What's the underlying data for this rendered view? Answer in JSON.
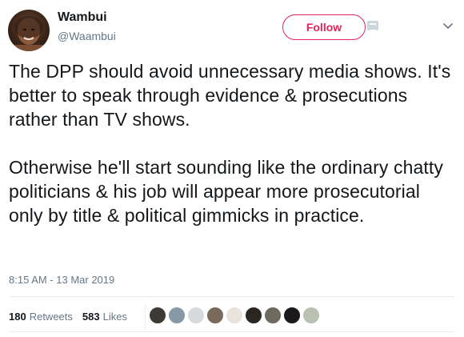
{
  "user": {
    "display_name": "Wambui",
    "handle": "@Waambui"
  },
  "follow_label": "Follow",
  "tweet": {
    "paragraphs": [
      "The DPP should avoid unnecessary media shows. It's better to speak through evidence & prosecutions rather than TV shows.",
      "Otherwise he'll start sounding like the ordinary chatty politicians & his job will appear more prosecutorial only by title & political gimmicks in practice."
    ]
  },
  "timestamp": "8:15 AM - 13 Mar 2019",
  "stats": {
    "retweets_count": "180",
    "retweets_label": "Retweets",
    "likes_count": "583",
    "likes_label": "Likes"
  },
  "colors": {
    "follow_accent": "#e0245e",
    "secondary_text": "#657786",
    "primary_text": "#14171a"
  },
  "liker_avatar_colors": [
    "#3d3a36",
    "#8899a6",
    "#d7d9db",
    "#7a6a5c",
    "#e9e3dc",
    "#2b2622",
    "#6e6a60",
    "#1a1a1a",
    "#b9c2b2"
  ]
}
